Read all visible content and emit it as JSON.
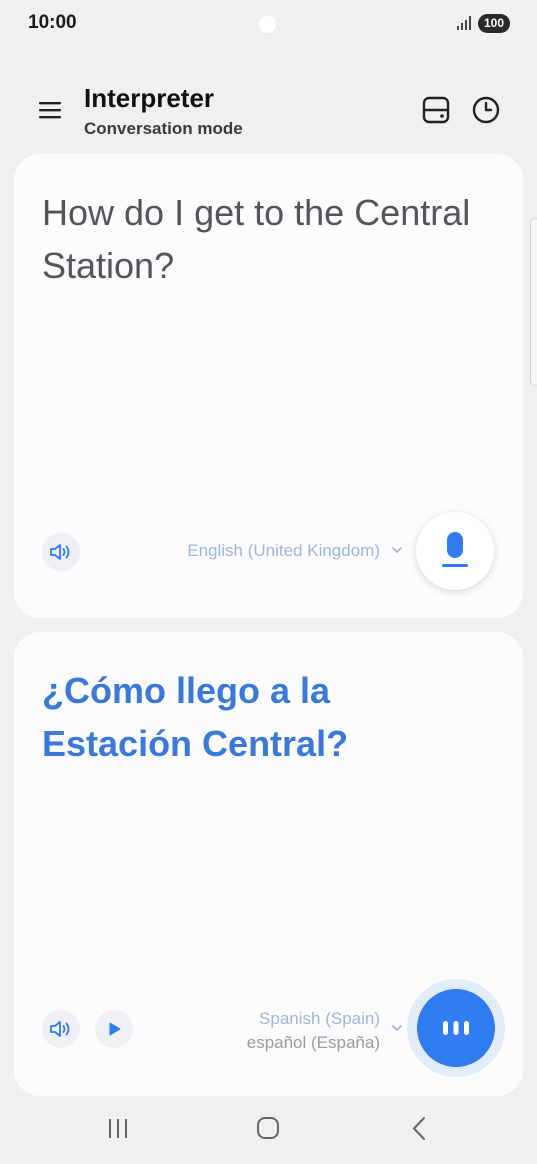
{
  "status_bar": {
    "time": "10:00",
    "battery": "100"
  },
  "header": {
    "title": "Interpreter",
    "subtitle": "Conversation mode"
  },
  "source_panel": {
    "text": "How do I get to the Central Station?",
    "language": "English (United Kingdom)"
  },
  "target_panel": {
    "text": "¿Cómo llego a la Estación Central?",
    "language": "Spanish (Spain)",
    "language_native": "español (España)"
  },
  "colors": {
    "accent": "#2F7BEF",
    "translated_text": "#3A78D9",
    "language_label": "#9DB6DE",
    "background": "#F0F0F3",
    "card": "#FCFCFE"
  },
  "icons": {
    "menu": "menu-icon",
    "layout": "split-view-icon",
    "history": "clock-icon",
    "speaker": "speaker-icon",
    "play": "play-icon",
    "mic": "microphone-icon",
    "listening": "listening-bars-icon",
    "chevron": "chevron-down-icon"
  }
}
